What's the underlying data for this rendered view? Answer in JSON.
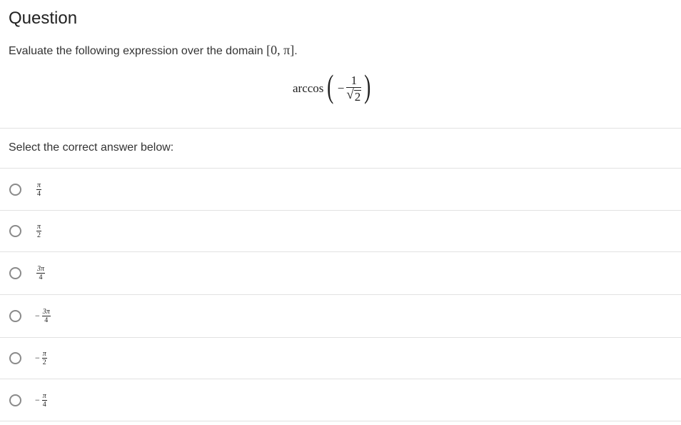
{
  "header": {
    "title": "Question"
  },
  "question": {
    "text": "Evaluate the following expression over the domain",
    "domain_math": "[0, π]",
    "domain_suffix": ".",
    "expression": {
      "function": "arccos",
      "sign": "−",
      "numerator": "1",
      "radical": "√",
      "radicand": "2"
    }
  },
  "answers": {
    "label": "Select the correct answer below:",
    "options": [
      {
        "sign": "",
        "numerator": "π",
        "denominator": "4"
      },
      {
        "sign": "",
        "numerator": "π",
        "denominator": "2"
      },
      {
        "sign": "",
        "numerator": "3π",
        "denominator": "4"
      },
      {
        "sign": "−",
        "numerator": "3π",
        "denominator": "4"
      },
      {
        "sign": "−",
        "numerator": "π",
        "denominator": "2"
      },
      {
        "sign": "−",
        "numerator": "π",
        "denominator": "4"
      }
    ]
  }
}
